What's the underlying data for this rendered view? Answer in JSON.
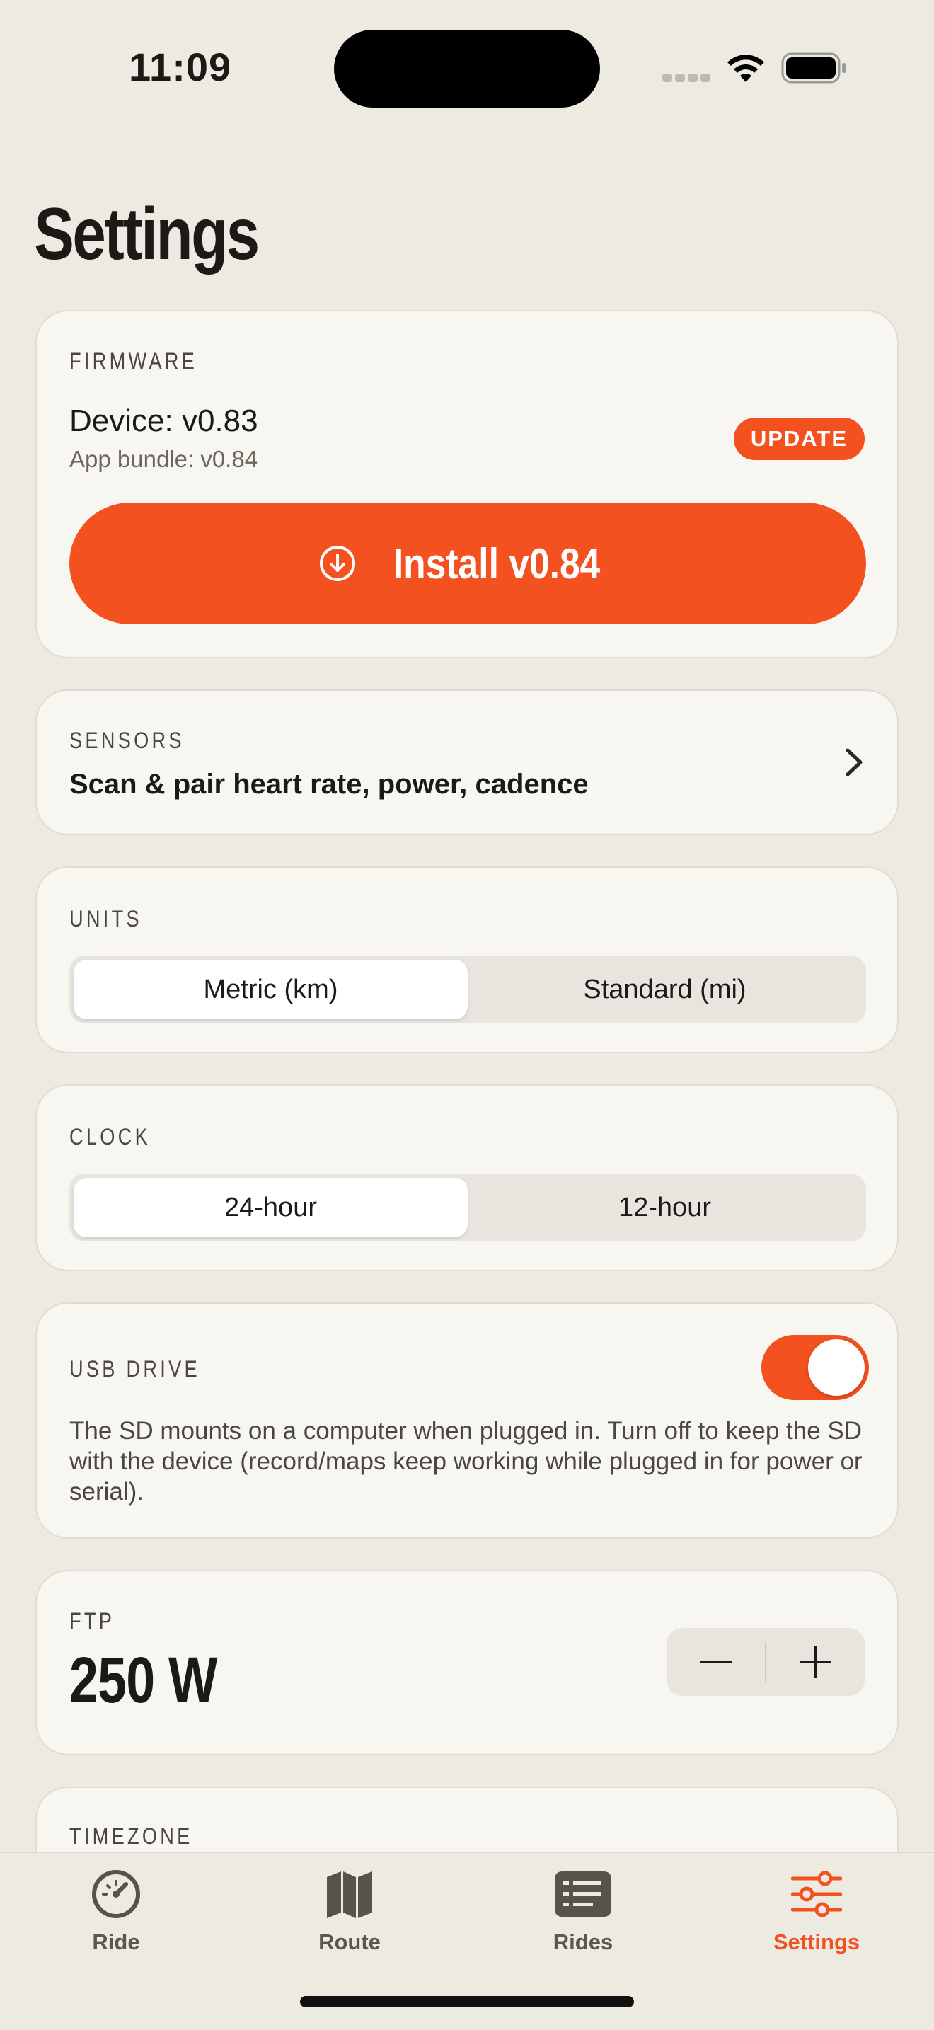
{
  "status_bar": {
    "time": "11:09"
  },
  "page": {
    "title": "Settings"
  },
  "firmware": {
    "label": "FIRMWARE",
    "device": "Device: v0.83",
    "bundle": "App bundle: v0.84",
    "badge": "UPDATE",
    "install_label": "Install v0.84"
  },
  "sensors": {
    "label": "SENSORS",
    "subtitle": "Scan & pair heart rate, power, cadence"
  },
  "units": {
    "label": "UNITS",
    "options": [
      "Metric (km)",
      "Standard (mi)"
    ],
    "selected": "Metric (km)"
  },
  "clock": {
    "label": "CLOCK",
    "options": [
      "24-hour",
      "12-hour"
    ],
    "selected": "24-hour"
  },
  "usb_drive": {
    "label": "USB DRIVE",
    "enabled": true,
    "description": "The SD mounts on a computer when plugged in. Turn off to keep the SD with the device (record/maps keep working while plugged in for power or serial)."
  },
  "ftp": {
    "label": "FTP",
    "value": "250 W"
  },
  "timezone": {
    "label": "TIMEZONE"
  },
  "tabs": [
    {
      "label": "Ride",
      "icon": "speedometer-icon",
      "active": false
    },
    {
      "label": "Route",
      "icon": "map-icon",
      "active": false
    },
    {
      "label": "Rides",
      "icon": "list-icon",
      "active": false
    },
    {
      "label": "Settings",
      "icon": "sliders-icon",
      "active": true
    }
  ],
  "colors": {
    "accent": "#f3511f",
    "background": "#edeae2",
    "card": "#f8f6f0"
  }
}
